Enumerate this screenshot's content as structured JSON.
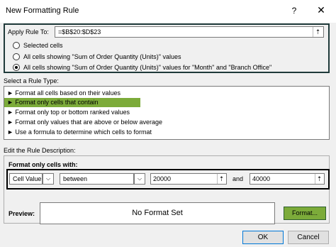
{
  "dialog": {
    "title": "New Formatting Rule",
    "help": "?",
    "close": "✕"
  },
  "apply_rule": {
    "label": "Apply Rule To:",
    "value": "=$B$20:$D$23",
    "ref_glyph": "⇡",
    "options": [
      {
        "label": "Selected cells",
        "checked": false
      },
      {
        "label": "All cells showing \"Sum of Order Quantity (Units)\" values",
        "checked": false
      },
      {
        "label": "All cells showing \"Sum of Order Quantity (Units)\" values for \"Month\" and \"Branch Office\"",
        "checked": true
      }
    ]
  },
  "rule_type": {
    "label": "Select a Rule Type:",
    "items": [
      "► Format all cells based on their values",
      "► Format only cells that contain",
      "► Format only top or bottom ranked values",
      "► Format only values that are above or below average",
      "► Use a formula to determine which cells to format"
    ],
    "selected_index": 1
  },
  "description": {
    "label": "Edit the Rule Description:",
    "sub_label": "Format only cells with:",
    "field": "Cell Value",
    "operator": "between",
    "value1": "20000",
    "and_label": "and",
    "value2": "40000",
    "arrow": "⌵",
    "ref_glyph": "⇡"
  },
  "preview": {
    "label": "Preview:",
    "text": "No Format Set",
    "format_button": "Format..."
  },
  "buttons": {
    "ok": "OK",
    "cancel": "Cancel"
  },
  "colors": {
    "highlight": "#7cab3a",
    "border_dark": "#1f3a3a"
  }
}
